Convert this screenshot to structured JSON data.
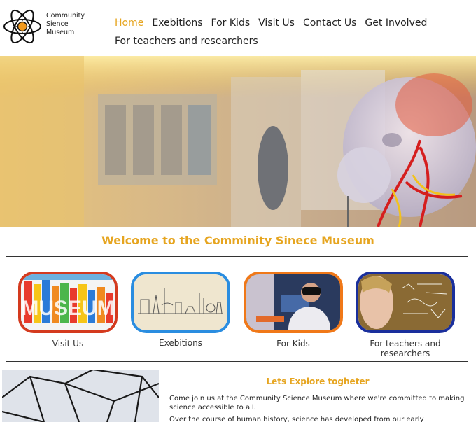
{
  "header": {
    "logo_line1": "Community",
    "logo_line2": "Sience",
    "logo_line3": "Museum"
  },
  "nav": {
    "items": [
      "Home",
      "Exebitions",
      "For Kids",
      "Visit Us",
      "Contact Us",
      "Get Involved",
      "For teachers and researchers"
    ],
    "active": "Home"
  },
  "welcome": {
    "title": "Welcome to the Comminity Sinece Museum"
  },
  "cards": [
    {
      "label": "Visit Us",
      "border_color": "#d43a1e"
    },
    {
      "label": "Exebitions",
      "border_color": "#2a8de0"
    },
    {
      "label": "For Kids",
      "border_color": "#f07818"
    },
    {
      "label": "For teachers and researchers",
      "border_color": "#1a2f9c"
    }
  ],
  "explore": {
    "title": "Lets Explore togheter",
    "para1": "Come join us at the Community Science Museum where we're committed to making science accessible to all.",
    "para2": "Over the course of human history, science has developed from our early understanding of"
  },
  "colors": {
    "accent": "#e6a520",
    "text": "#222222"
  }
}
